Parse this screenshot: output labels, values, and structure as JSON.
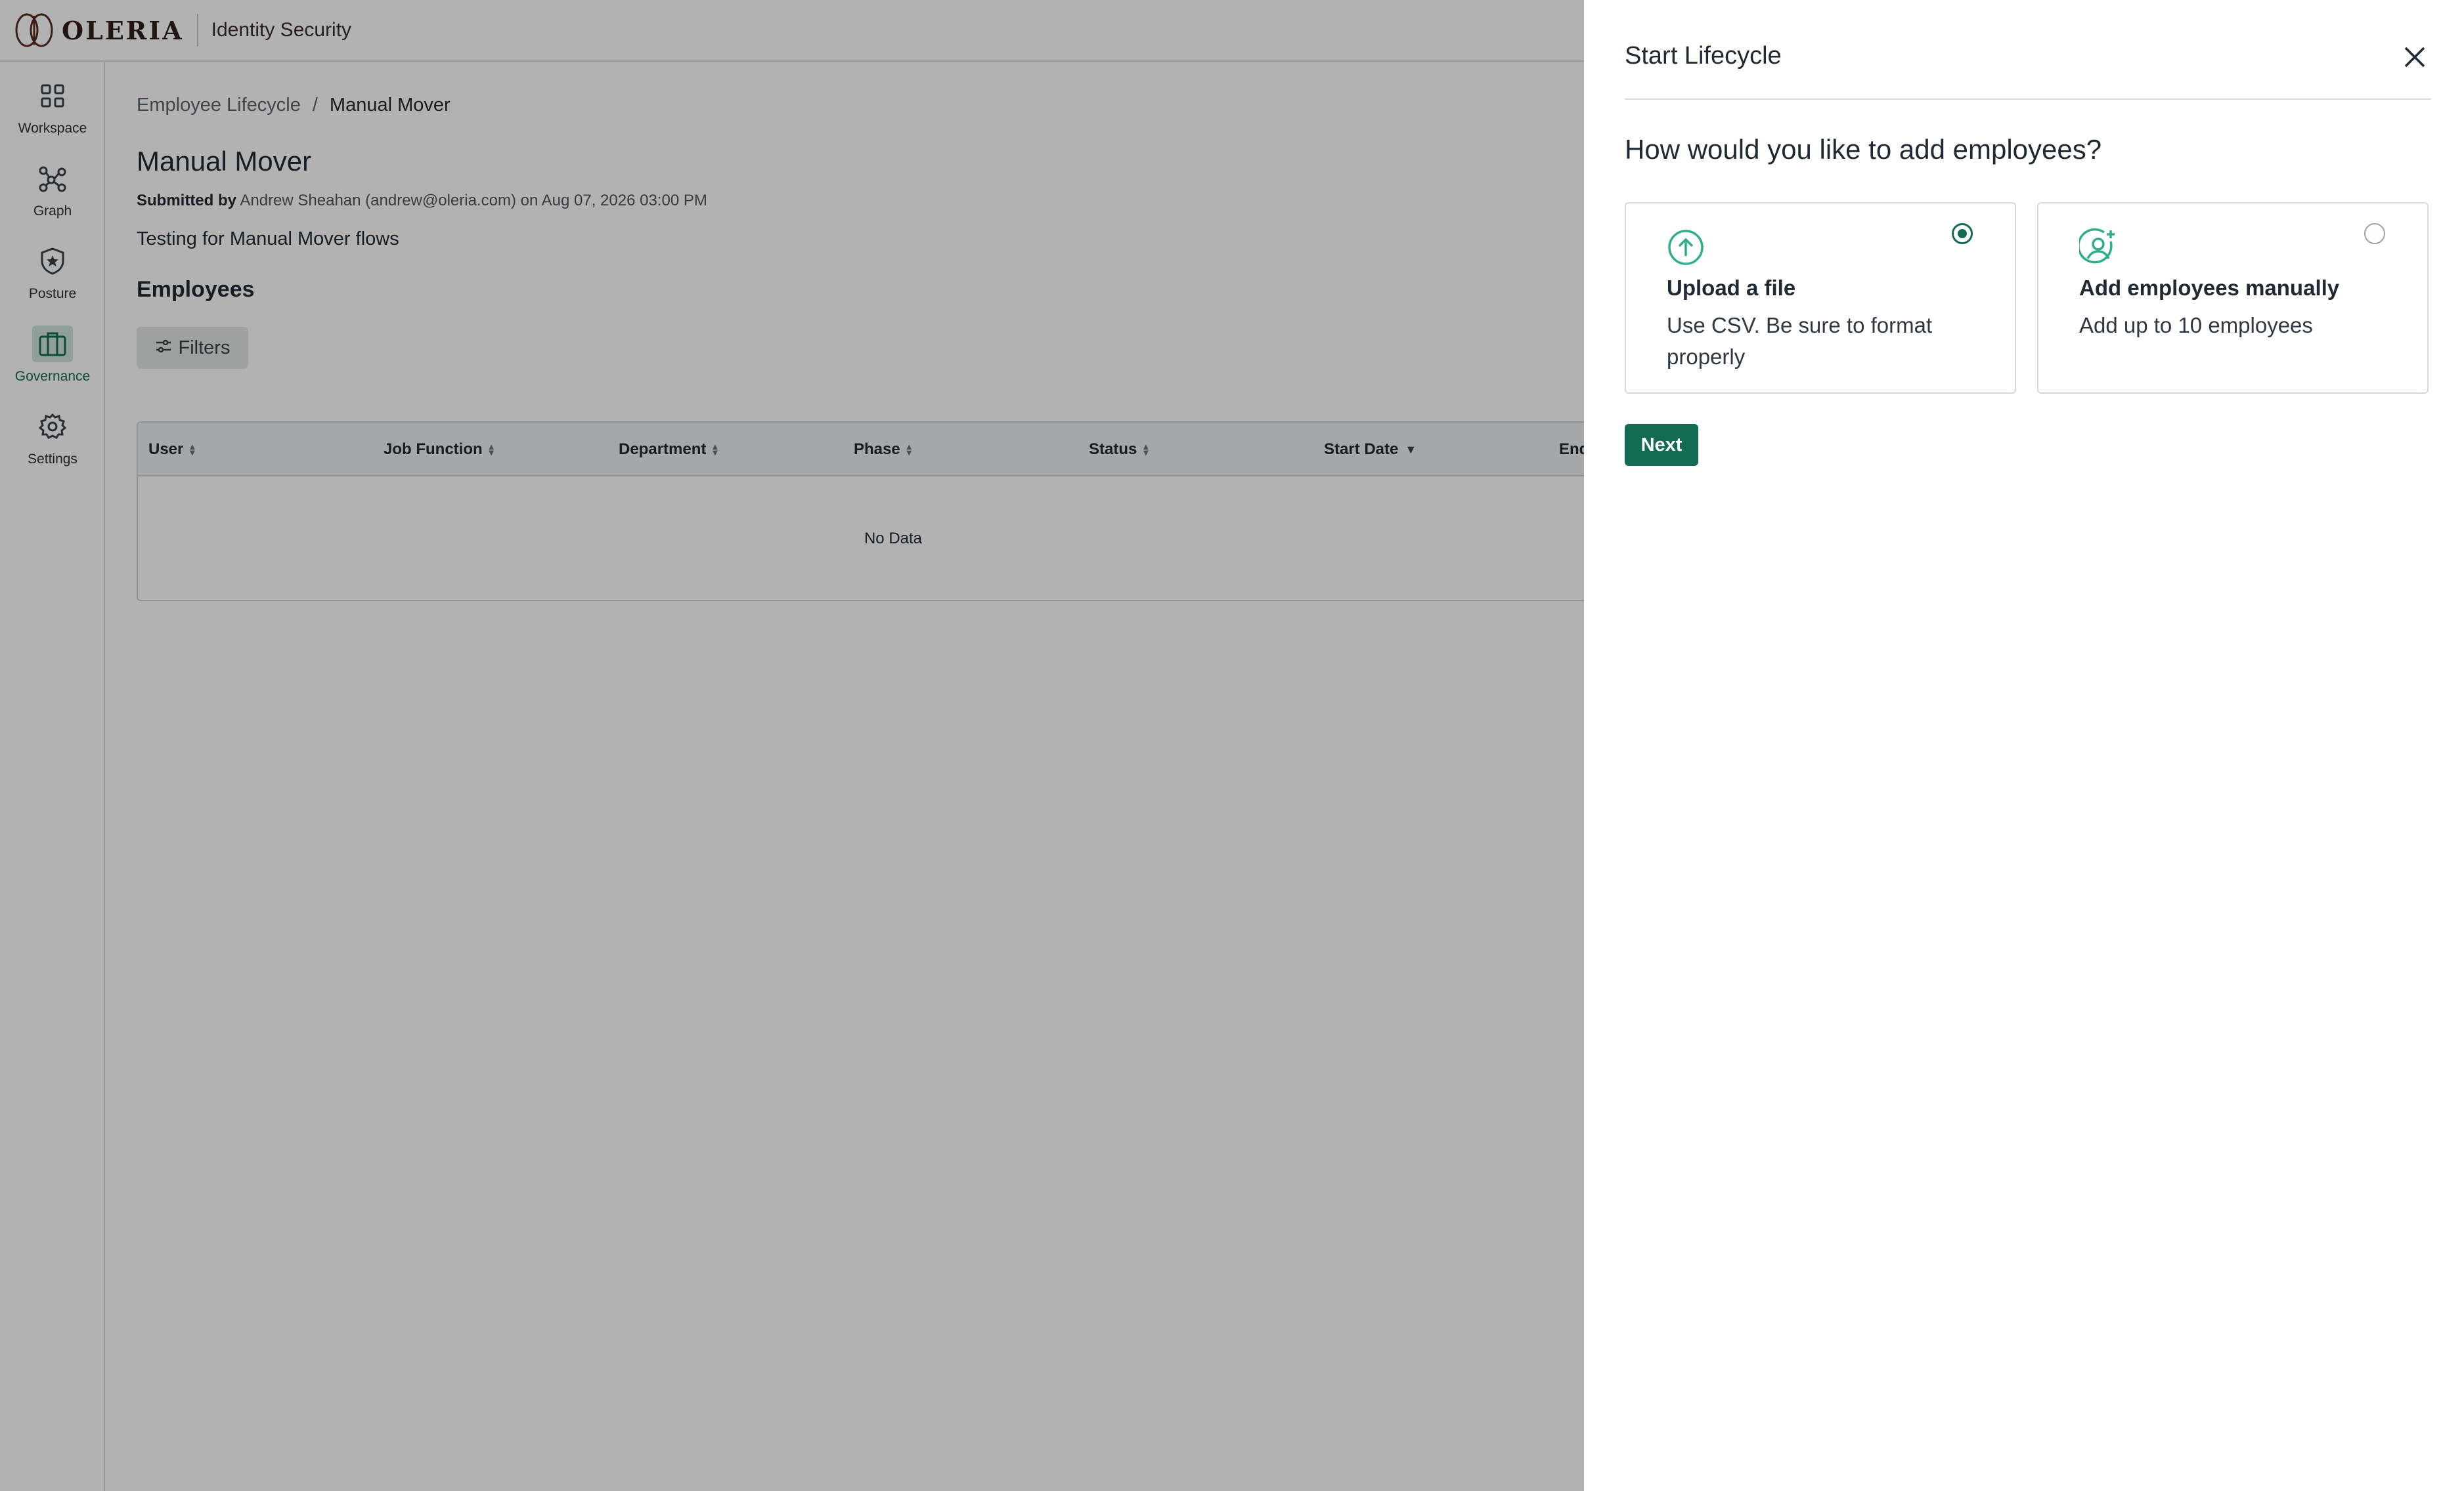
{
  "header": {
    "brand": "OLERIA",
    "product": "Identity Security"
  },
  "sidebar": {
    "items": [
      {
        "label": "Workspace",
        "icon": "grid-icon"
      },
      {
        "label": "Graph",
        "icon": "graph-icon"
      },
      {
        "label": "Posture",
        "icon": "shield-star-icon"
      },
      {
        "label": "Governance",
        "icon": "briefcase-icon",
        "active": true
      },
      {
        "label": "Settings",
        "icon": "gear-icon"
      }
    ]
  },
  "main": {
    "breadcrumb": {
      "parent": "Employee Lifecycle",
      "separator": "/",
      "current": "Manual Mover"
    },
    "title": "Manual Mover",
    "submitted": {
      "prefix": "Submitted by",
      "text": "Andrew Sheahan (andrew@oleria.com) on Aug 07, 2026 03:00 PM"
    },
    "description": "Testing for Manual Mover flows",
    "section_title": "Employees",
    "filters_label": "Filters",
    "table": {
      "columns": [
        "User",
        "Job Function",
        "Department",
        "Phase",
        "Status",
        "Start Date",
        "End"
      ],
      "sorted_column": "Start Date",
      "empty_text": "No Data"
    }
  },
  "drawer": {
    "title": "Start Lifecycle",
    "question": "How would you like to add employees?",
    "options": [
      {
        "title": "Upload a file",
        "description": "Use CSV. Be sure to format properly",
        "icon": "upload-icon",
        "selected": true
      },
      {
        "title": "Add employees manually",
        "description": "Add up to 10 employees",
        "icon": "add-user-icon",
        "selected": false
      }
    ],
    "next_label": "Next"
  },
  "colors": {
    "accent": "#136a55",
    "accent_light": "#2fae8b",
    "overlay": "rgba(0,0,0,0.30)"
  }
}
